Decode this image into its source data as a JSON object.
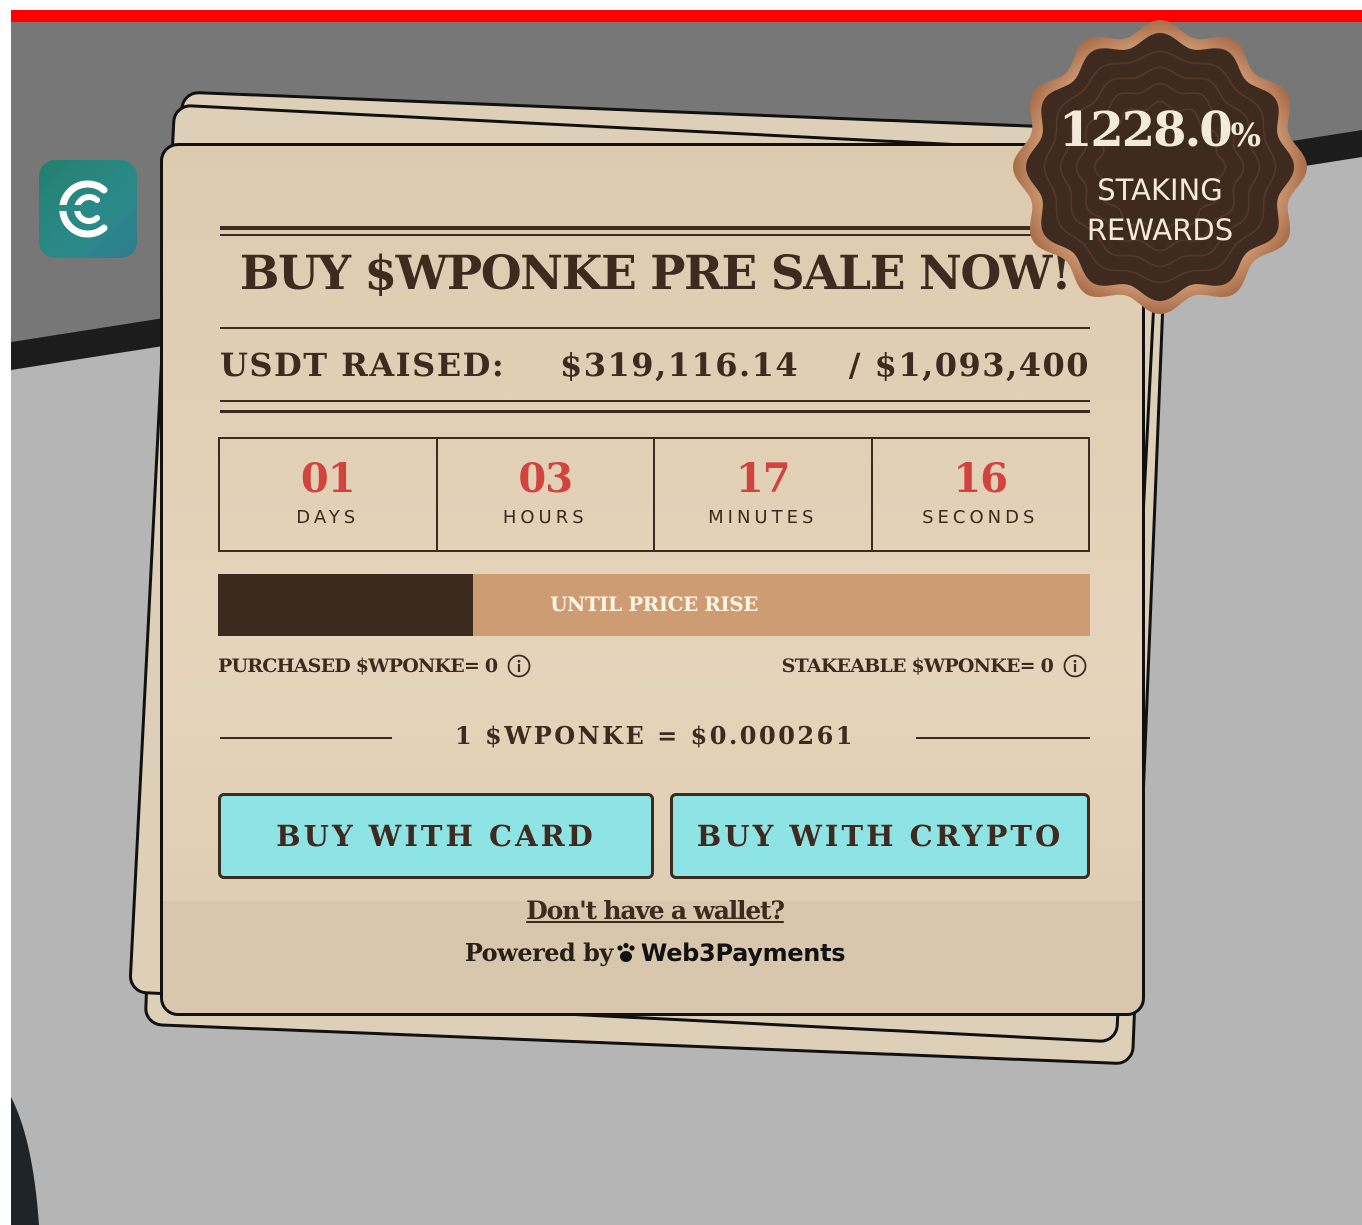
{
  "colors": {
    "top_bar": "#ff0000",
    "card_background": "#ddcbb0",
    "text_dark": "#3e2a1e",
    "countdown_numbers": "#d0433e",
    "progress_fill": "#3d2a1f",
    "progress_track": "#cd9c73",
    "buy_buttons": "#8ee4e4",
    "badge": "#3f2a1f",
    "badge_rim": "#b47a56",
    "app_logo": "#23806f"
  },
  "app_logo": {
    "icon": "cs-brand-logo-icon"
  },
  "badge": {
    "rate": "1228.0",
    "rate_unit": "%",
    "line1": "STAKING",
    "line2": "REWARDS"
  },
  "presale": {
    "title": "BUY $WPONKE PRE SALE NOW!",
    "raised_label": "USDT RAISED:",
    "raised_amount": "$319,116.14",
    "raised_target": "/ $1,093,400",
    "countdown": [
      {
        "value": "01",
        "unit": "DAYS"
      },
      {
        "value": "03",
        "unit": "HOURS"
      },
      {
        "value": "17",
        "unit": "MINUTES"
      },
      {
        "value": "16",
        "unit": "SECONDS"
      }
    ],
    "progress": {
      "label": "UNTIL PRICE RISE",
      "fraction": 0.292
    },
    "purchased": "PURCHASED $WPONKE= 0",
    "stakeable": "STAKEABLE $WPONKE= 0",
    "info_icon": "info-icon",
    "price": "1 $WPONKE = $0.000261",
    "buy_card": "BUY WITH CARD",
    "buy_crypto": "BUY WITH CRYPTO",
    "wallet_link": "Don't have a wallet?",
    "powered_by": "Powered by",
    "powered_brand": "Web3Payments",
    "powered_icon": "paw-icon"
  }
}
